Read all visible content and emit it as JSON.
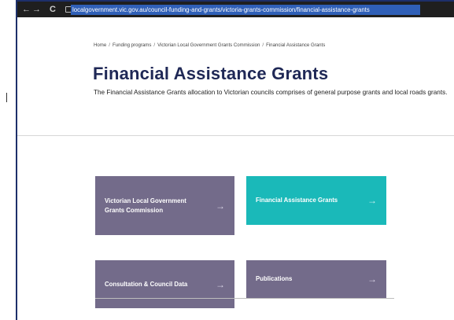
{
  "browser": {
    "url": "localgovernment.vic.gov.au/council-funding-and-grants/victoria-grants-commission/financial-assistance-grants"
  },
  "breadcrumb": {
    "items": [
      "Home",
      "Funding programs",
      "Victorian Local Government Grants Commission",
      "Financial Assistance Grants"
    ],
    "separator": "/"
  },
  "page": {
    "title": "Financial Assistance Grants",
    "description": "The Financial Assistance Grants allocation to Victorian councils comprises of general purpose grants and local roads grants."
  },
  "tiles": [
    {
      "label": "Victorian Local Government Grants Commission",
      "color": "#736b8a"
    },
    {
      "label": "Financial Assistance Grants",
      "color": "#1ab9b9"
    },
    {
      "label": "Consultation & Council Data",
      "color": "#736b8a"
    },
    {
      "label": "Publications",
      "color": "#736b8a"
    }
  ],
  "icons": {
    "back": "←",
    "reload": "C",
    "tile_arrow": "→"
  }
}
